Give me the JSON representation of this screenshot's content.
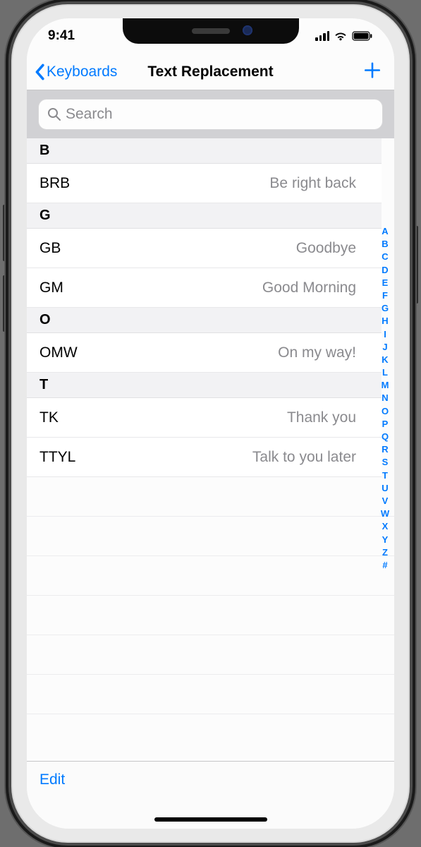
{
  "status": {
    "time": "9:41"
  },
  "nav": {
    "back_label": "Keyboards",
    "title": "Text Replacement"
  },
  "search": {
    "placeholder": "Search"
  },
  "sections": [
    {
      "letter": "B",
      "items": [
        {
          "shortcut": "BRB",
          "phrase": "Be right back"
        }
      ]
    },
    {
      "letter": "G",
      "items": [
        {
          "shortcut": "GB",
          "phrase": "Goodbye"
        },
        {
          "shortcut": "GM",
          "phrase": "Good Morning"
        }
      ]
    },
    {
      "letter": "O",
      "items": [
        {
          "shortcut": "OMW",
          "phrase": "On my way!"
        }
      ]
    },
    {
      "letter": "T",
      "items": [
        {
          "shortcut": "TK",
          "phrase": "Thank you"
        },
        {
          "shortcut": "TTYL",
          "phrase": "Talk to you later"
        }
      ]
    }
  ],
  "empty_rows": 6,
  "alpha_index": [
    "A",
    "B",
    "C",
    "D",
    "E",
    "F",
    "G",
    "H",
    "I",
    "J",
    "K",
    "L",
    "M",
    "N",
    "O",
    "P",
    "Q",
    "R",
    "S",
    "T",
    "U",
    "V",
    "W",
    "X",
    "Y",
    "Z",
    "#"
  ],
  "toolbar": {
    "edit_label": "Edit"
  },
  "colors": {
    "accent": "#007aff"
  }
}
